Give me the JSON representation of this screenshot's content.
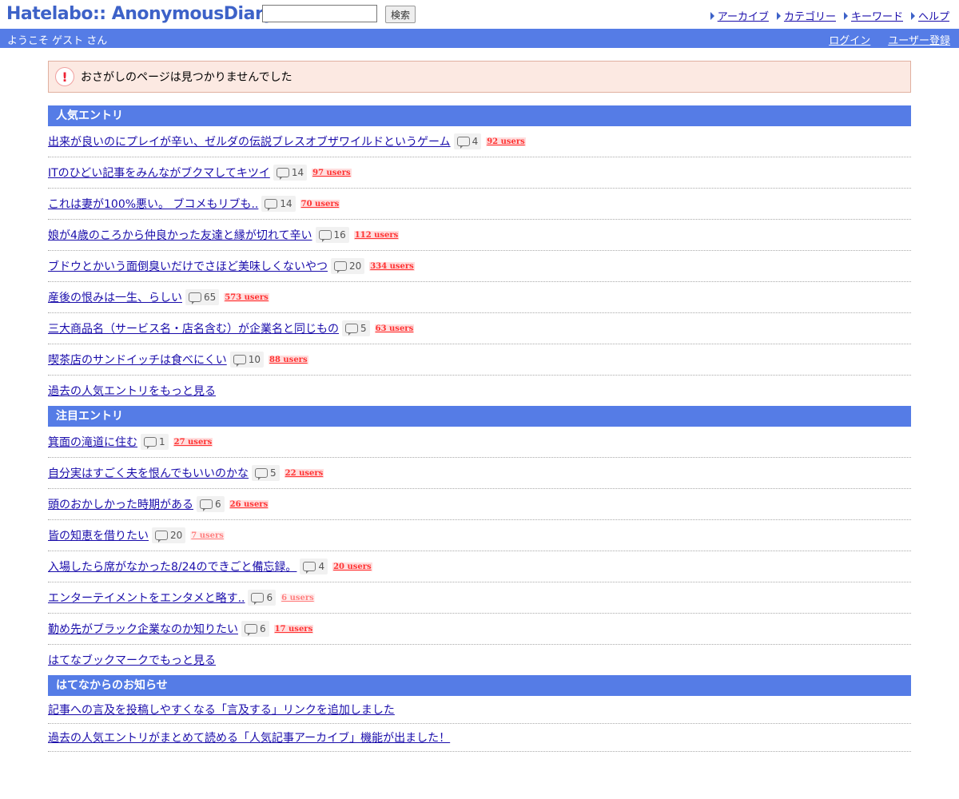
{
  "header": {
    "logo": "Hatelabo:: AnonymousDiary",
    "search_placeholder": "",
    "search_button": "検索",
    "nav": [
      "アーカイブ",
      "カテゴリー",
      "キーワード",
      "ヘルプ"
    ]
  },
  "userbar": {
    "welcome": "ようこそ ゲスト さん",
    "login": "ログイン",
    "register": "ユーザー登録"
  },
  "notice": {
    "icon": "!",
    "text": "おさがしのページは見つかりませんでした"
  },
  "sections": {
    "popular": {
      "title": "人気エントリ",
      "entries": [
        {
          "title": "出来が良いのにプレイが辛い、ゼルダの伝説ブレスオブザワイルドというゲーム",
          "comments": "4",
          "users": "92 users"
        },
        {
          "title": "ITのひどい記事をみんながブクマしてキツイ",
          "comments": "14",
          "users": "97 users"
        },
        {
          "title": "これは妻が100%悪い。 ブコメもリブも..",
          "comments": "14",
          "users": "70 users"
        },
        {
          "title": "娘が4歳のころから仲良かった友達と縁が切れて辛い",
          "comments": "16",
          "users": "112 users"
        },
        {
          "title": "ブドウとかいう面倒臭いだけでさほど美味しくないやつ",
          "comments": "20",
          "users": "334 users"
        },
        {
          "title": "産後の恨みは一生、らしい",
          "comments": "65",
          "users": "573 users"
        },
        {
          "title": "三大商品名（サービス名・店名含む）が企業名と同じもの",
          "comments": "5",
          "users": "63 users"
        },
        {
          "title": "喫茶店のサンドイッチは食べにくい",
          "comments": "10",
          "users": "88 users"
        }
      ],
      "more": "過去の人気エントリをもっと見る"
    },
    "featured": {
      "title": "注目エントリ",
      "entries": [
        {
          "title": "箕面の滝道に住む",
          "comments": "1",
          "users": "27 users"
        },
        {
          "title": "自分実はすごく夫を恨んでもいいのかな",
          "comments": "5",
          "users": "22 users"
        },
        {
          "title": "頭のおかしかった時期がある",
          "comments": "6",
          "users": "26 users"
        },
        {
          "title": "皆の知恵を借りたい",
          "comments": "20",
          "users": "7 users"
        },
        {
          "title": "入場したら席がなかった8/24のできごと備忘録。",
          "comments": "4",
          "users": "20 users"
        },
        {
          "title": "エンターテイメントをエンタメと略す..",
          "comments": "6",
          "users": "6 users"
        },
        {
          "title": "勤め先がブラック企業なのか知りたい",
          "comments": "6",
          "users": "17 users"
        }
      ],
      "more": "はてなブックマークでもっと見る"
    },
    "news": {
      "title": "はてなからのお知らせ",
      "entries": [
        {
          "title": "記事への言及を投稿しやすくなる「言及する」リンクを追加しました"
        },
        {
          "title": "過去の人気エントリがまとめて読める「人気記事アーカイブ」機能が出ました！"
        }
      ]
    }
  },
  "colors": {
    "accent": "#557ce6",
    "logo": "#3d62c8",
    "notice_bg": "#fce9e2",
    "users_red": "#ff3333"
  }
}
